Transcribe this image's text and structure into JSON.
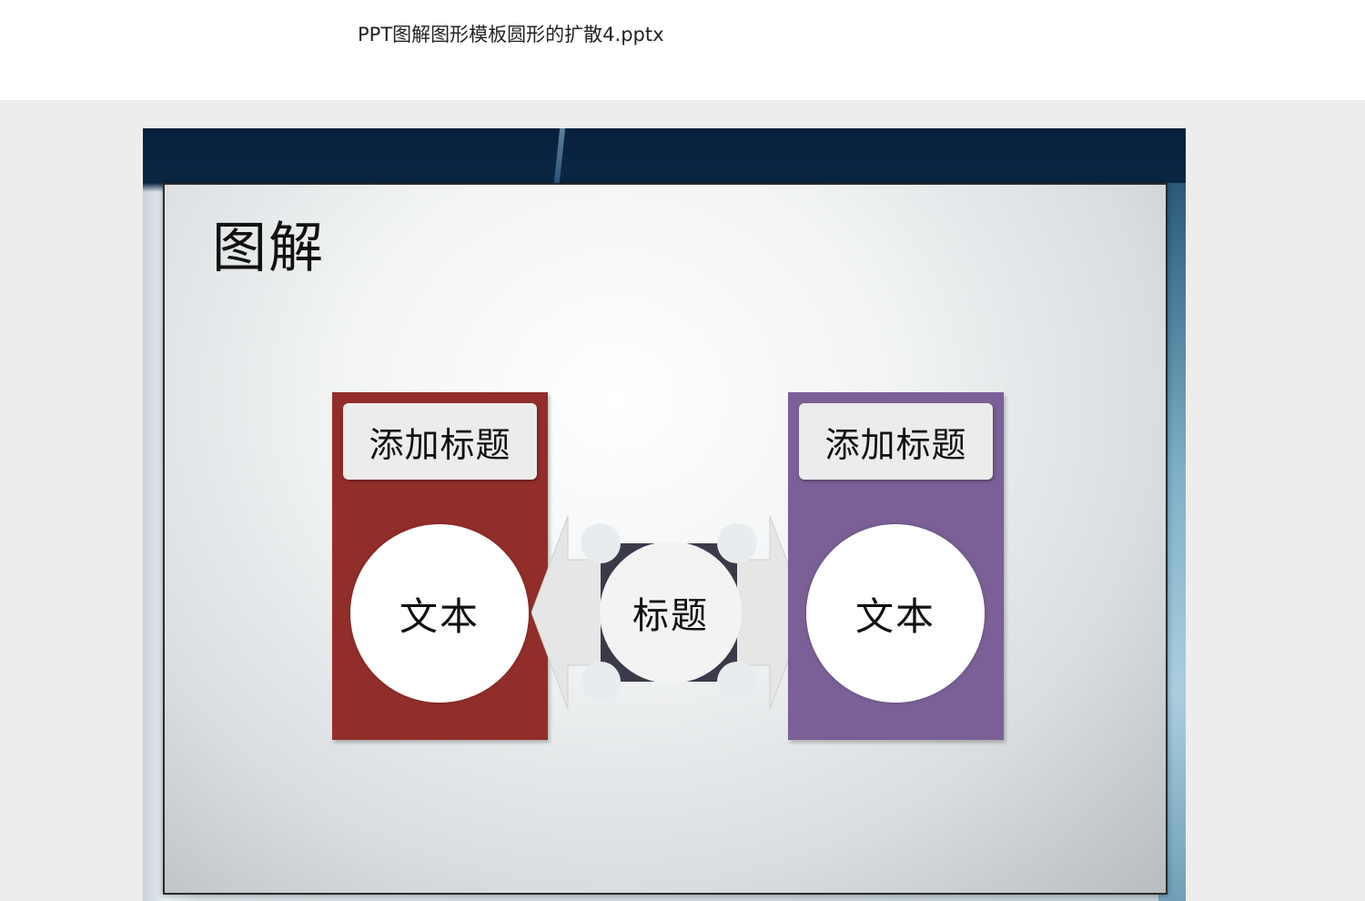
{
  "window": {
    "title": "PPT图解图形模板圆形的扩散4.pptx"
  },
  "slide": {
    "heading": "图解",
    "left_card": {
      "title": "添加标题",
      "text": "文本",
      "color": "#922e2a"
    },
    "right_card": {
      "title": "添加标题",
      "text": "文本",
      "color": "#7a6096"
    },
    "center": {
      "label": "标题",
      "color": "#3a3a4a"
    }
  }
}
